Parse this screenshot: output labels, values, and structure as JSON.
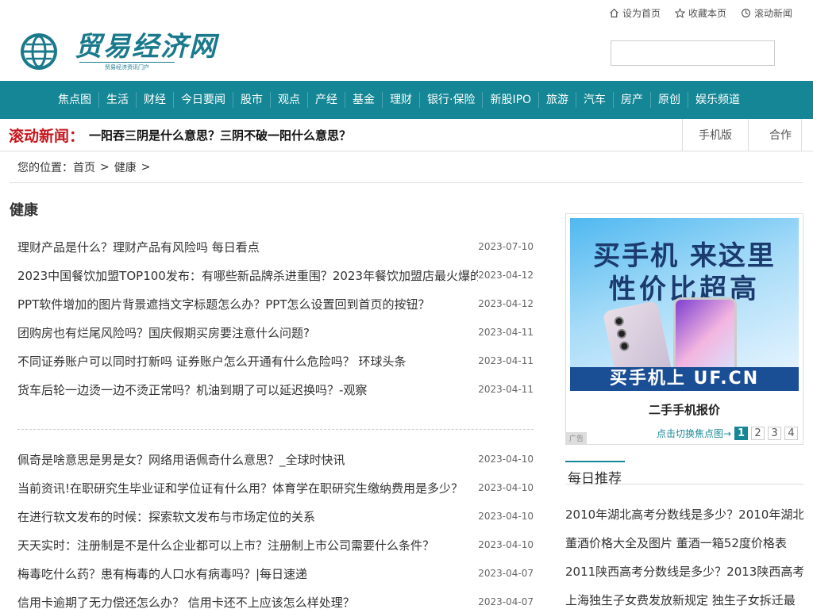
{
  "top_links": [
    {
      "label": "设为首页",
      "icon": "home-icon"
    },
    {
      "label": "收藏本页",
      "icon": "star-icon"
    },
    {
      "label": "滚动新闻",
      "icon": "refresh-icon"
    }
  ],
  "logo": {
    "title": "贸易经济网",
    "subtitle": "贸易经济资讯门户"
  },
  "search": {
    "value": ""
  },
  "nav": [
    "焦点图",
    "生活",
    "财经",
    "今日要闻",
    "股市",
    "观点",
    "产经",
    "基金",
    "理财",
    "银行·保险",
    "新股IPO",
    "旅游",
    "汽车",
    "房产",
    "原创",
    "娱乐频道"
  ],
  "scroll": {
    "label": "滚动新闻：",
    "headline": "一阳吞三阴是什么意思？三阴不破一阳什么意思？",
    "mobile": "手机版",
    "cooperate": "合作"
  },
  "breadcrumb": {
    "prefix": "您的位置：",
    "home": "首页",
    "sep1": ">",
    "current": "健康",
    "sep2": ">"
  },
  "category_title": "健康",
  "list1": [
    {
      "title": "理财产品是什么？理财产品有风险吗 每日看点",
      "date": "2023-07-10"
    },
    {
      "title": "2023中国餐饮加盟TOP100发布：有哪些新品牌杀进重围？2023年餐饮加盟店最火爆的",
      "date": "2023-04-12"
    },
    {
      "title": "PPT软件增加的图片背景遮挡文字标题怎么办？PPT怎么设置回到首页的按钮？",
      "date": "2023-04-12"
    },
    {
      "title": "团购房也有烂尾风险吗？国庆假期买房要注意什么问题?",
      "date": "2023-04-11"
    },
    {
      "title": "不同证券账户可以同时打新吗 证券账户怎么开通有什么危险吗？ 环球头条",
      "date": "2023-04-11"
    },
    {
      "title": "货车后轮一边烫一边不烫正常吗？机油到期了可以延迟换吗？-观察",
      "date": "2023-04-11"
    }
  ],
  "list2": [
    {
      "title": "佩奇是啥意思是男是女？网络用语佩奇什么意思？_全球时快讯",
      "date": "2023-04-10"
    },
    {
      "title": "当前资讯!在职研究生毕业证和学位证有什么用？体育学在职研究生缴纳费用是多少？",
      "date": "2023-04-10"
    },
    {
      "title": "在进行软文发布的时候：探索软文发布与市场定位的关系",
      "date": "2023-04-10"
    },
    {
      "title": "天天实时：注册制是不是什么企业都可以上市？注册制上市公司需要什么条件？",
      "date": "2023-04-10"
    },
    {
      "title": "梅毒吃什么药？患有梅毒的人口水有病毒吗？|每日速递",
      "date": "2023-04-07"
    },
    {
      "title": "信用卡逾期了无力偿还怎么办？ 信用卡还不上应该怎么样处理？",
      "date": "2023-04-07"
    }
  ],
  "ad": {
    "line1": "买手机 来这里",
    "line2": "性价比超高",
    "banner": "买手机上 UF.CN",
    "caption": "二手手机报价",
    "switch_label": "点击切换焦点图→",
    "pages": [
      "1",
      "2",
      "3",
      "4"
    ],
    "tag": "广告"
  },
  "daily": {
    "title": "每日推荐",
    "items": [
      "2010年湖北高考分数线是多少？2010年湖北",
      "董酒价格大全及图片 董酒一箱52度价格表",
      "2011陕西高考分数线是多少？2013陕西高考",
      "上海独生子女费发放新规定 独生子女拆迁最"
    ]
  },
  "colors": {
    "accent": "#148695",
    "scroll_red": "#c8151d"
  }
}
